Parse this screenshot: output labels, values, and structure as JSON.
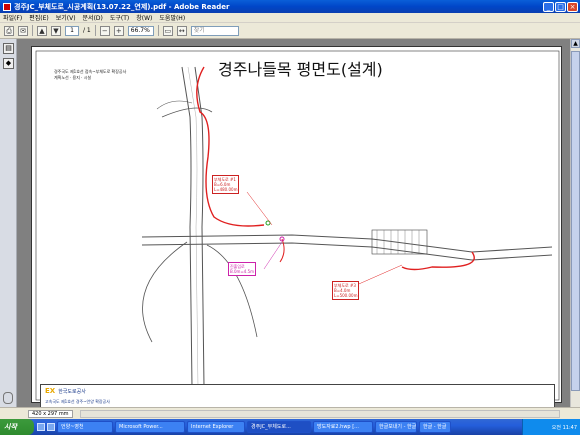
{
  "window": {
    "title": "경주JC_부체도로_시공계획(13.07.22_연제).pdf - Adobe Reader"
  },
  "menu": [
    "파일(F)",
    "편집(E)",
    "보기(V)",
    "문서(D)",
    "도구(T)",
    "창(W)",
    "도움말(H)"
  ],
  "toolbar": {
    "page_current": "1",
    "page_total": "/ 1",
    "zoom": "66.7%",
    "find_placeholder": "찾기"
  },
  "drawing": {
    "title": "경주나들목 평면도(설계)",
    "note_line1": "경주국도 제1호선 접속~부체도로 확장공사",
    "note_line2": "계획노선 · 용지 · 시설",
    "labels": [
      {
        "line1": "부체도로 #1",
        "line2": "B=6.0m",
        "line3": "L=480.00m"
      },
      {
        "line1": "진출입로",
        "line2": "B.0m=4.5m",
        "line3": ""
      },
      {
        "line1": "부체도로 #3",
        "line2": "B=4.0m",
        "line3": "L=500.00m"
      }
    ],
    "titleblock": {
      "logo": "EX",
      "corp": "한국도로공사",
      "sub": "고속국도 제1호선 경주~언양 확장공사"
    }
  },
  "status": {
    "page_size": "420 x 297 mm"
  },
  "taskbar": {
    "start": "시작",
    "tasks": [
      "언양~영천",
      "Microsoft Power...",
      "Internet Explorer",
      "경주JC_부체도로...",
      "방도자료2.hwp [...",
      "한글보내기 - 한글",
      "한글 - 한글"
    ],
    "clock": "오전 11:47"
  },
  "colors": {
    "road_red": "#e02020",
    "road_line": "#555555"
  }
}
